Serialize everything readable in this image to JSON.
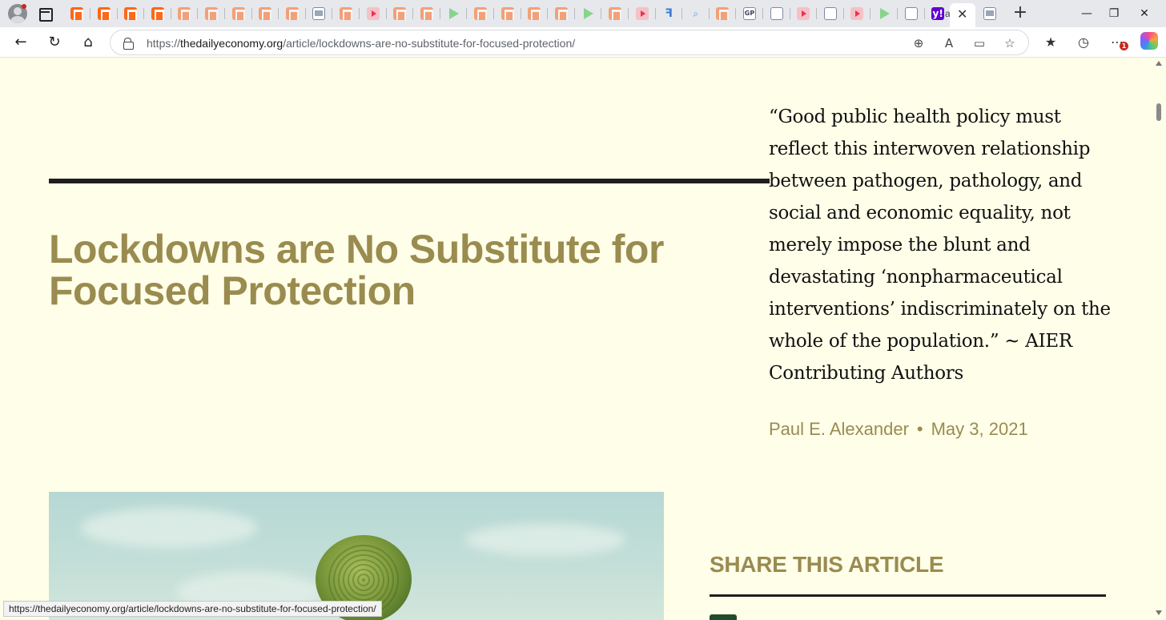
{
  "browser": {
    "url_scheme": "https://",
    "url_host": "thedailyeconomy.org",
    "url_path": "/article/lockdowns-are-no-substitute-for-focused-protection/",
    "active_tab_prefix": "a",
    "status_url": "https://thedailyeconomy.org/article/lockdowns-are-no-substitute-for-focused-protection/",
    "notification_count": "1",
    "tab_favicons": [
      "substack",
      "substack",
      "substack",
      "substack",
      "substack-dim",
      "substack-dim",
      "substack-dim",
      "substack-dim",
      "substack-dim",
      "news",
      "substack-dim",
      "youtube",
      "substack-dim",
      "substack-dim",
      "play",
      "substack-dim",
      "substack-dim",
      "substack-dim",
      "substack-dim",
      "play",
      "substack-dim",
      "youtube",
      "translate",
      "search",
      "substack-dim",
      "gp",
      "box",
      "youtube",
      "ai",
      "youtube",
      "play",
      "box",
      "yahoo"
    ]
  },
  "article": {
    "title": "Lockdowns are No Substitute for Focused Protection",
    "pull_quote": "“Good public health policy must reflect this interwoven relationship between pathogen, pathology, and social and economic equality, not merely impose the blunt and devastating ‘nonpharmaceutical interventions’ indiscriminately on the whole of the population.” ~ AIER Contributing Authors",
    "author": "Paul E. Alexander",
    "separator": "•",
    "date": "May 3, 2021",
    "share_heading": "SHARE THIS ARTICLE"
  },
  "colors": {
    "page_bg": "#fefee9",
    "accent_olive": "#9a8b4f",
    "rule": "#1e1e1e"
  }
}
